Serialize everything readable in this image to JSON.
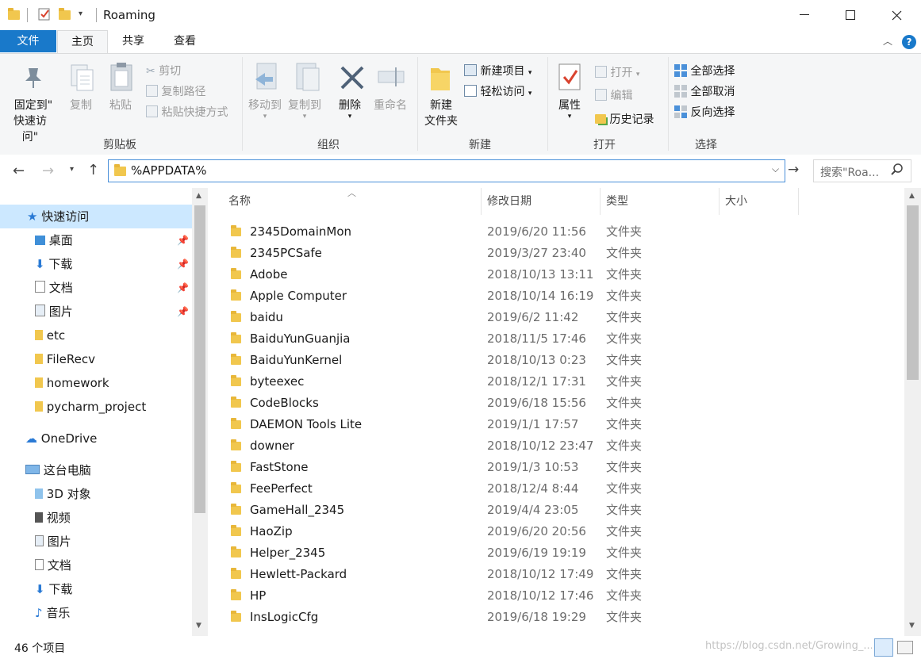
{
  "window": {
    "title": "Roaming"
  },
  "tabs": {
    "file": "文件",
    "home": "主页",
    "share": "共享",
    "view": "查看"
  },
  "ribbon": {
    "clipboard": {
      "label": "剪贴板",
      "pin_line1": "固定到\"",
      "pin_line2": "快速访问\"",
      "copy": "复制",
      "paste": "粘贴",
      "cut": "剪切",
      "copy_path": "复制路径",
      "paste_shortcut": "粘贴快捷方式"
    },
    "organize": {
      "label": "组织",
      "move_to": "移动到",
      "copy_to": "复制到",
      "delete": "删除",
      "rename": "重命名"
    },
    "new": {
      "label": "新建",
      "new_folder_l1": "新建",
      "new_folder_l2": "文件夹",
      "new_item": "新建项目",
      "easy_access": "轻松访问"
    },
    "open": {
      "label": "打开",
      "properties": "属性",
      "open": "打开",
      "edit": "编辑",
      "history": "历史记录"
    },
    "select": {
      "label": "选择",
      "select_all": "全部选择",
      "select_none": "全部取消",
      "invert": "反向选择"
    }
  },
  "address": {
    "path": "%APPDATA%",
    "search_placeholder": "搜索\"Roa..."
  },
  "nav": {
    "quick_access": "快速访问",
    "pinned": [
      "桌面",
      "下载",
      "文档",
      "图片"
    ],
    "folders": [
      "etc",
      "FileRecv",
      "homework",
      "pycharm_project"
    ],
    "onedrive": "OneDrive",
    "this_pc": "这台电脑",
    "pc_items": [
      "3D 对象",
      "视频",
      "图片",
      "文档",
      "下载",
      "音乐"
    ]
  },
  "columns": {
    "name": "名称",
    "date": "修改日期",
    "type": "类型",
    "size": "大小"
  },
  "files": [
    {
      "name": "2345DomainMon",
      "date": "2019/6/20 11:56",
      "type": "文件夹"
    },
    {
      "name": "2345PCSafe",
      "date": "2019/3/27 23:40",
      "type": "文件夹"
    },
    {
      "name": "Adobe",
      "date": "2018/10/13 13:11",
      "type": "文件夹"
    },
    {
      "name": "Apple Computer",
      "date": "2018/10/14 16:19",
      "type": "文件夹"
    },
    {
      "name": "baidu",
      "date": "2019/6/2 11:42",
      "type": "文件夹"
    },
    {
      "name": "BaiduYunGuanjia",
      "date": "2018/11/5 17:46",
      "type": "文件夹"
    },
    {
      "name": "BaiduYunKernel",
      "date": "2018/10/13 0:23",
      "type": "文件夹"
    },
    {
      "name": "byteexec",
      "date": "2018/12/1 17:31",
      "type": "文件夹"
    },
    {
      "name": "CodeBlocks",
      "date": "2019/6/18 15:56",
      "type": "文件夹"
    },
    {
      "name": "DAEMON Tools Lite",
      "date": "2019/1/1 17:57",
      "type": "文件夹"
    },
    {
      "name": "downer",
      "date": "2018/10/12 23:47",
      "type": "文件夹"
    },
    {
      "name": "FastStone",
      "date": "2019/1/3 10:53",
      "type": "文件夹"
    },
    {
      "name": "FeePerfect",
      "date": "2018/12/4 8:44",
      "type": "文件夹"
    },
    {
      "name": "GameHall_2345",
      "date": "2019/4/4 23:05",
      "type": "文件夹"
    },
    {
      "name": "HaoZip",
      "date": "2019/6/20 20:56",
      "type": "文件夹"
    },
    {
      "name": "Helper_2345",
      "date": "2019/6/19 19:19",
      "type": "文件夹"
    },
    {
      "name": "Hewlett-Packard",
      "date": "2018/10/12 17:49",
      "type": "文件夹"
    },
    {
      "name": "HP",
      "date": "2018/10/12 17:46",
      "type": "文件夹"
    },
    {
      "name": "InsLogicCfg",
      "date": "2019/6/18 19:29",
      "type": "文件夹"
    }
  ],
  "status": {
    "count": "46 个项目",
    "watermark": "https://blog.csdn.net/Growing_..."
  },
  "colors": {
    "accent": "#1979ca",
    "folder": "#f1c74e",
    "ribbon_bg": "#f5f6f7"
  }
}
